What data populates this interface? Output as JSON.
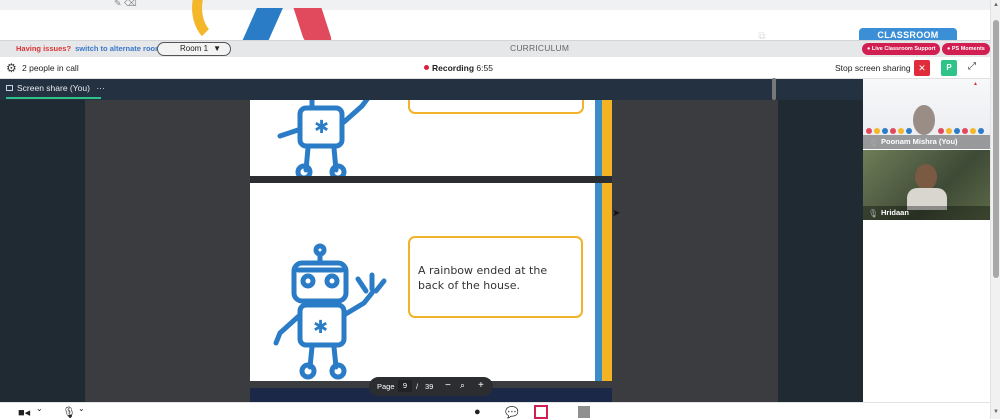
{
  "topbar": {
    "tools": "✎ ⌫"
  },
  "classroom_tab": "CLASSROOM",
  "roombar": {
    "issue_text": "Having issues?",
    "alternate_link": "switch to alternate room",
    "room_select": "Room 1",
    "curriculum": "CURRICULUM",
    "live_support": "Live Classroom Support",
    "moments": "PS Moments"
  },
  "callbar": {
    "people": "2 people in call",
    "recording_label": "Recording",
    "recording_time": "6:55",
    "stop_share": "Stop screen sharing",
    "close_glyph": "✕",
    "p_glyph": "P"
  },
  "stage": {
    "tab_label": "Screen share (You)",
    "tab_more": "···"
  },
  "slides": {
    "slide2_text_line1": "A rainbow ended at the",
    "slide2_text_line2": "back of the house."
  },
  "pagebar": {
    "page_label": "Page",
    "current_page": "9",
    "separator": "/",
    "total_pages": "39",
    "zoom_out": "−",
    "zoom_in": "+"
  },
  "participants": [
    {
      "name": "Poonam Mishra (You)"
    },
    {
      "name": "Hridaan"
    }
  ],
  "colors": {
    "accent_green": "#2fc38a",
    "danger_red": "#e02b3a",
    "brand_blue": "#3a8fd6",
    "slide_blue": "#3a8dc9",
    "slide_yellow": "#f3b323"
  },
  "icons": [
    "gear-icon",
    "recording-dot-icon",
    "close-icon",
    "expand-icon",
    "popout-icon",
    "camera-icon",
    "microphone-icon",
    "person-icon",
    "chat-icon",
    "screen-share-icon",
    "stop-icon"
  ]
}
